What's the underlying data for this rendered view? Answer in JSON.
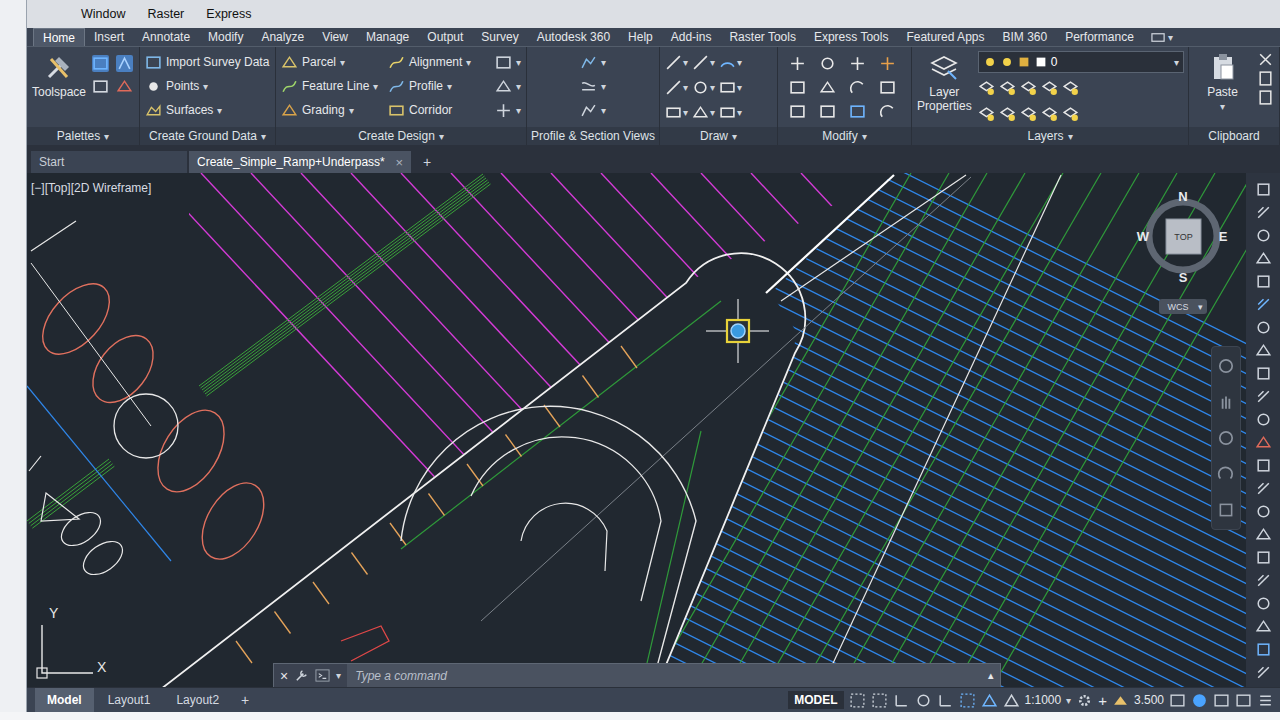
{
  "menu_bar": [
    "Window",
    "Raster",
    "Express"
  ],
  "caret": "▾",
  "ribbon_tabs": [
    {
      "label": "Home",
      "selected": true
    },
    {
      "label": "Insert",
      "selected": false
    },
    {
      "label": "Annotate",
      "selected": false
    },
    {
      "label": "Modify",
      "selected": false
    },
    {
      "label": "Analyze",
      "selected": false
    },
    {
      "label": "View",
      "selected": false
    },
    {
      "label": "Manage",
      "selected": false
    },
    {
      "label": "Output",
      "selected": false
    },
    {
      "label": "Survey",
      "selected": false
    },
    {
      "label": "Autodesk 360",
      "selected": false
    },
    {
      "label": "Help",
      "selected": false
    },
    {
      "label": "Add-ins",
      "selected": false
    },
    {
      "label": "Raster Tools",
      "selected": false
    },
    {
      "label": "Express Tools",
      "selected": false
    },
    {
      "label": "Featured Apps",
      "selected": false
    },
    {
      "label": "BIM 360",
      "selected": false
    },
    {
      "label": "Performance",
      "selected": false
    }
  ],
  "palettes_panel": {
    "title": "Palettes",
    "dropdown": true,
    "button": "Toolspace"
  },
  "ground_panel": {
    "title": "Create Ground Data",
    "dropdown": true,
    "items": [
      {
        "label": "Import Survey Data",
        "dropdown": false
      },
      {
        "label": "Points",
        "dropdown": true
      },
      {
        "label": "Surfaces",
        "dropdown": true
      }
    ]
  },
  "design_panel": {
    "title": "Create Design",
    "dropdown": true,
    "columns": [
      [
        {
          "label": "Parcel",
          "dropdown": true
        },
        {
          "label": "Feature Line",
          "dropdown": true
        },
        {
          "label": "Grading",
          "dropdown": true
        }
      ],
      [
        {
          "label": "Alignment",
          "dropdown": true
        },
        {
          "label": "Profile",
          "dropdown": true
        },
        {
          "label": "Corridor",
          "dropdown": false
        }
      ]
    ]
  },
  "views_panel": {
    "title": "Profile & Section Views",
    "dropdown": false
  },
  "draw_panel": {
    "title": "Draw",
    "dropdown": true
  },
  "modify_panel": {
    "title": "Modify",
    "dropdown": true
  },
  "layers_panel": {
    "title": "Layers",
    "dropdown": true,
    "button": "Layer Properties",
    "current_layer": "0"
  },
  "clipboard_panel": {
    "title": "Clipboard",
    "dropdown": false,
    "button": "Paste"
  },
  "file_tabs": [
    {
      "label": "Start",
      "selected": false,
      "closable": false
    },
    {
      "label": "Create_Simple_Ramp+Underpass*",
      "selected": true,
      "closable": true
    }
  ],
  "close_glyph": "×",
  "new_tab": "+",
  "viewport_label": "[−][Top][2D Wireframe]",
  "viewcube": {
    "top": "TOP",
    "north": "N",
    "south": "S",
    "east": "E",
    "west": "W",
    "ucs": "WCS"
  },
  "ucs_icon": {
    "x": "X",
    "y": "Y"
  },
  "command_line": {
    "placeholder": "Type a command",
    "expand": "▴"
  },
  "layout_tabs": [
    {
      "label": "Model",
      "selected": true
    },
    {
      "label": "Layout1",
      "selected": false
    },
    {
      "label": "Layout2",
      "selected": false
    }
  ],
  "status_bar": {
    "space": "MODEL",
    "scale": "1:1000",
    "annotation_value": "3.500"
  }
}
